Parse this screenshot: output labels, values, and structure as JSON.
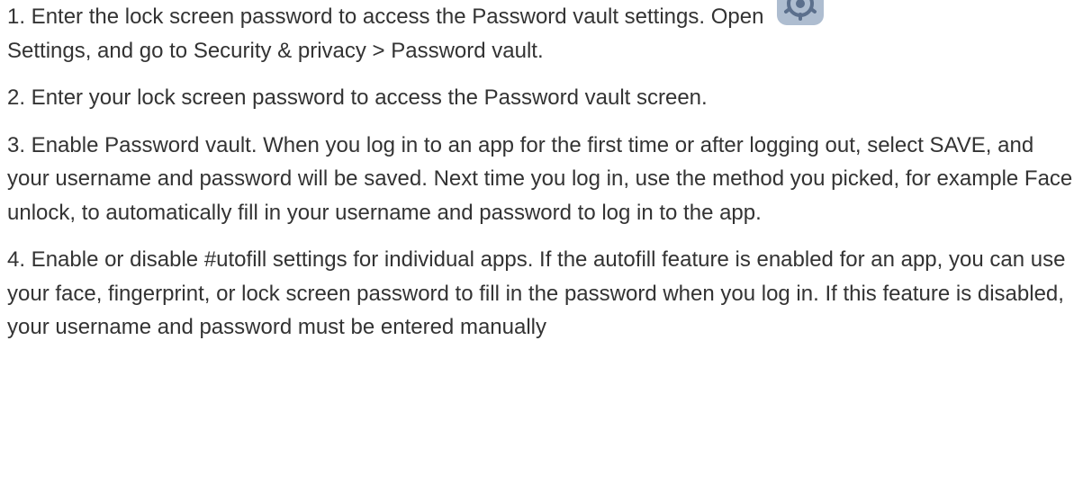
{
  "steps": [
    {
      "text_before_icon": "1. Enter the lock screen password to access the Password vault settings. Open ",
      "icon": "settings-gear-icon",
      "text_after_icon": "Settings, and go to Security & privacy > Password vault."
    },
    {
      "text": "2. Enter your lock screen password to access the Password vault screen."
    },
    {
      "text": "3. Enable Password vault. When you log in to an app for the first time or after logging out, select SAVE, and your username and password will be saved. Next time you log in, use the method you picked, for example Face unlock, to automatically fill in your username and password to log in to the app."
    },
    {
      "text": "4. Enable or disable #utofill settings for individual apps. If the autofill feature is enabled for an app, you can use your face, fingerprint, or lock screen password to fill in the password when you log in. If this feature is disabled, your username and password must be entered manually"
    }
  ],
  "colors": {
    "text": "#333333",
    "icon_background": "#aebdd0",
    "icon_foreground": "#5b6f8c"
  }
}
